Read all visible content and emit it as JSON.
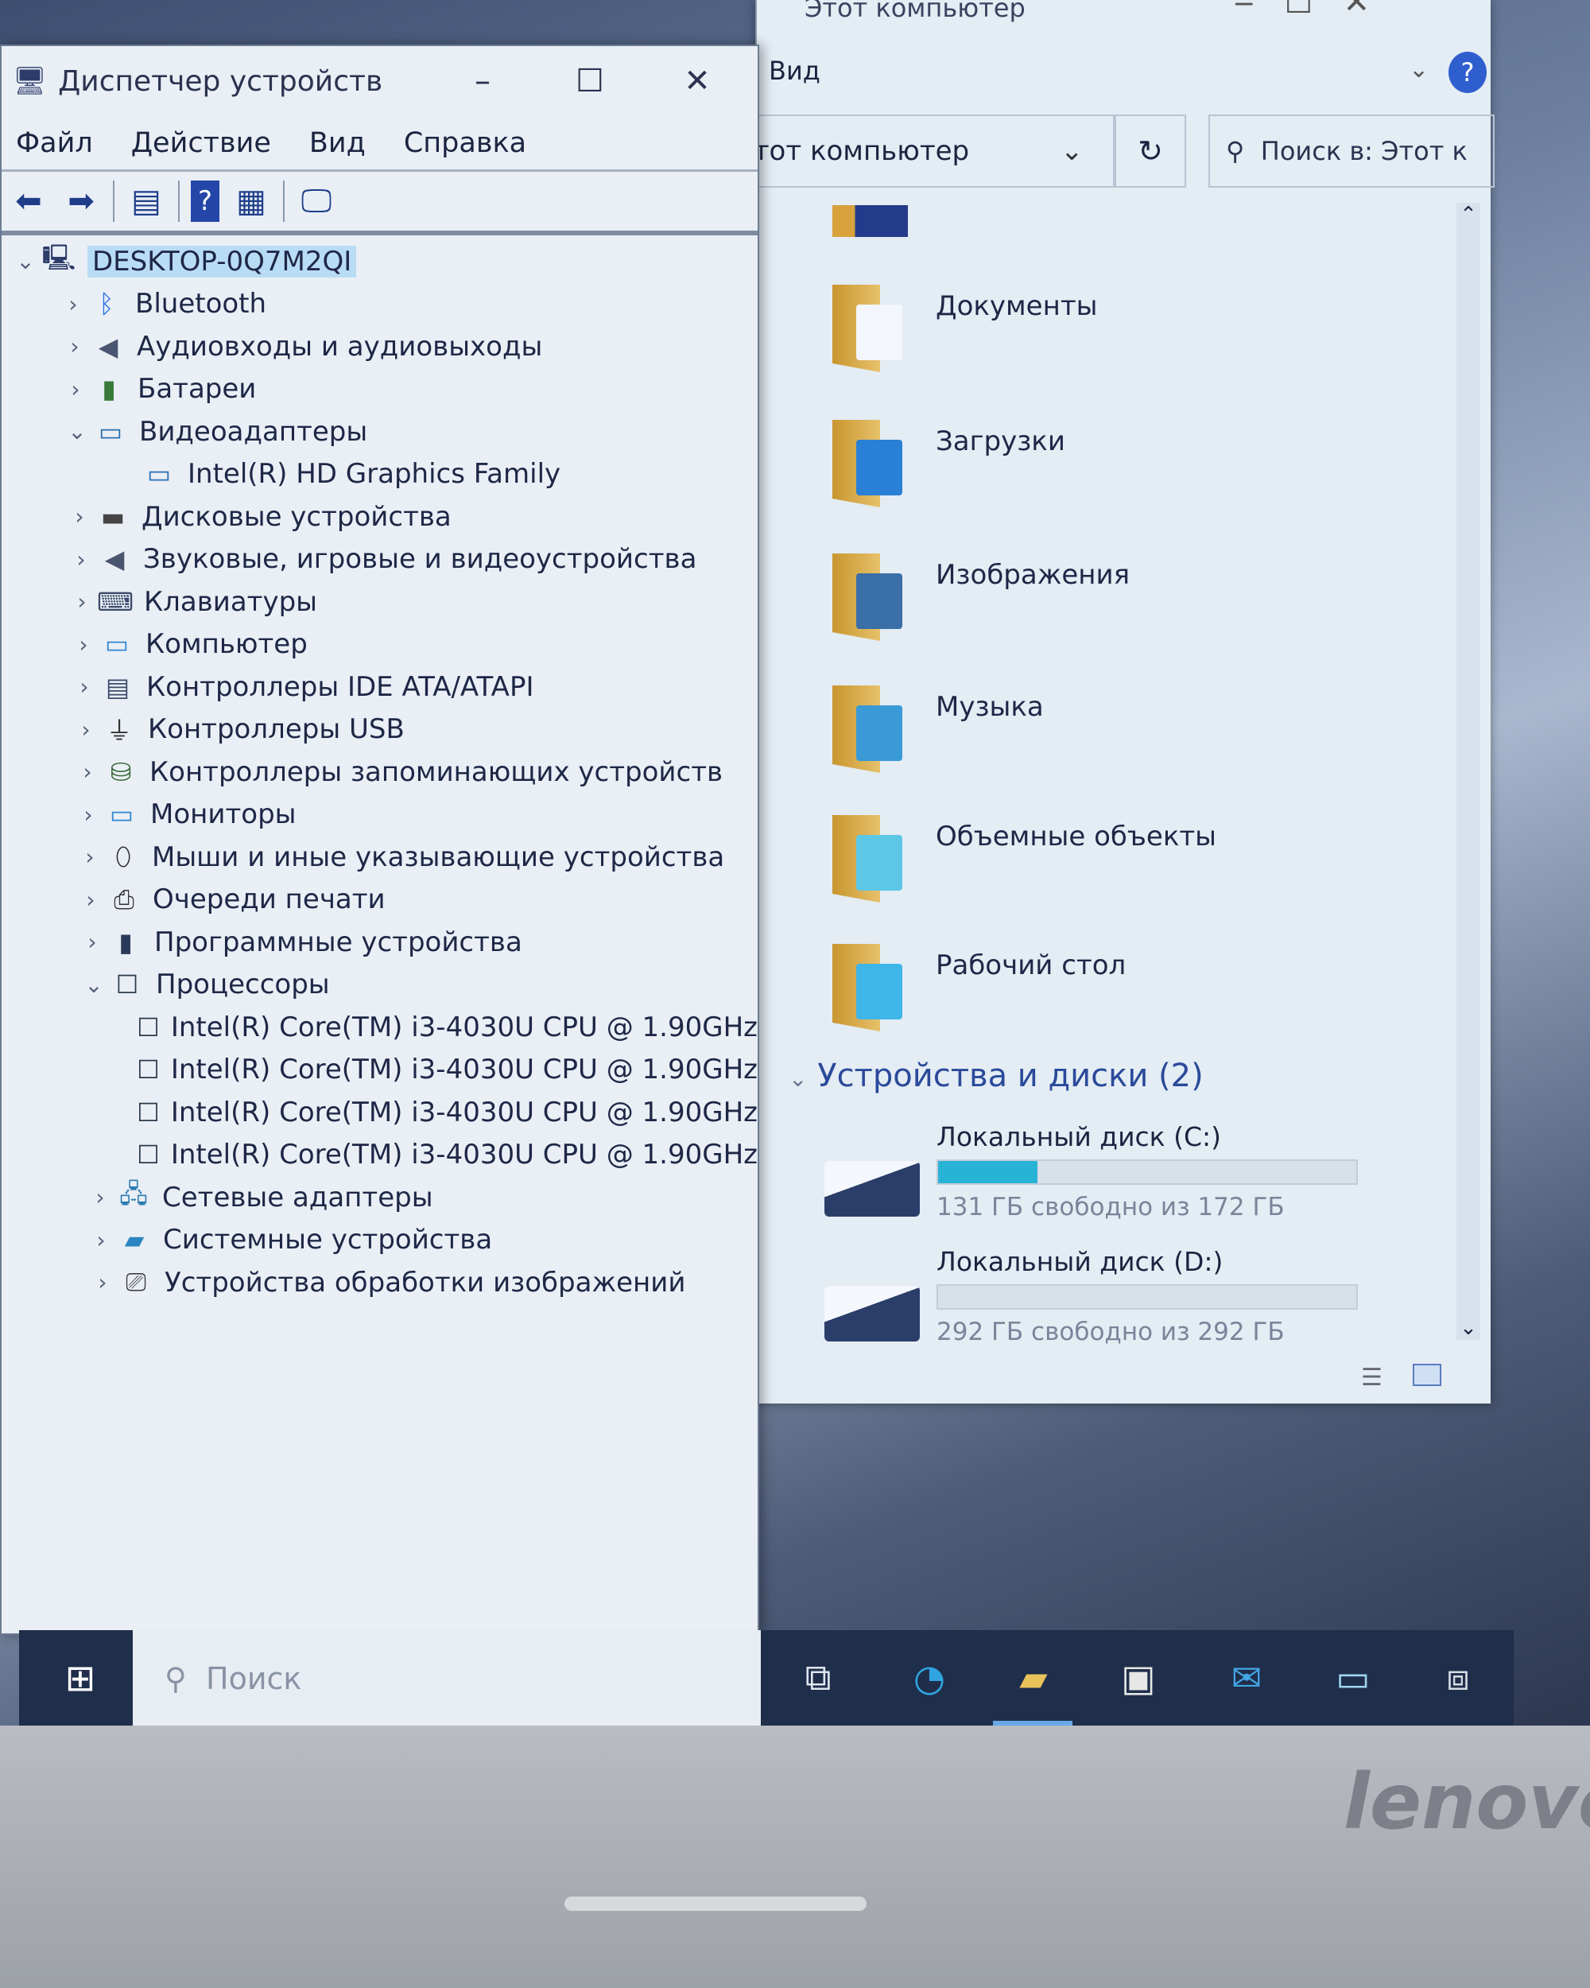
{
  "explorer": {
    "title": "Этот компьютер",
    "ribbon_tab": "Вид",
    "address": "Этот компьютер",
    "search_placeholder": "Поиск в: Этот к",
    "folders": [
      "Документы",
      "Загрузки",
      "Изображения",
      "Музыка",
      "Объемные объекты",
      "Рабочий стол"
    ],
    "section": "Устройства и диски (2)",
    "drives": [
      {
        "label": "Локальный диск (C:)",
        "status": "131 ГБ свободно из 172 ГБ",
        "used_fraction": 0.238
      },
      {
        "label": "Локальный диск (D:)",
        "status": "292 ГБ свободно из 292 ГБ",
        "used_fraction": 0.0
      }
    ]
  },
  "device_manager": {
    "title": "Диспетчер устройств",
    "menu": [
      "Файл",
      "Действие",
      "Вид",
      "Справка"
    ],
    "root": "DESKTOP-0Q7M2QI",
    "tree": [
      {
        "label": "Bluetooth",
        "icon": "bluetooth-icon",
        "expanded": false
      },
      {
        "label": "Аудиовходы и аудиовыходы",
        "icon": "speaker-icon",
        "expanded": false
      },
      {
        "label": "Батареи",
        "icon": "battery-icon",
        "expanded": false
      },
      {
        "label": "Видеоадаптеры",
        "icon": "display-adapter-icon",
        "expanded": true
      },
      {
        "label": "Intel(R) HD Graphics Family",
        "icon": "display-adapter-icon",
        "child": true
      },
      {
        "label": "Дисковые устройства",
        "icon": "disk-icon",
        "expanded": false
      },
      {
        "label": "Звуковые, игровые и видеоустройства",
        "icon": "speaker-icon",
        "expanded": false
      },
      {
        "label": "Клавиатуры",
        "icon": "keyboard-icon",
        "expanded": false
      },
      {
        "label": "Компьютер",
        "icon": "monitor-icon",
        "expanded": false
      },
      {
        "label": "Контроллеры IDE ATA/ATAPI",
        "icon": "ide-controller-icon",
        "expanded": false
      },
      {
        "label": "Контроллеры USB",
        "icon": "usb-icon",
        "expanded": false
      },
      {
        "label": "Контроллеры запоминающих устройств",
        "icon": "storage-controller-icon",
        "expanded": false
      },
      {
        "label": "Мониторы",
        "icon": "monitor-icon",
        "expanded": false
      },
      {
        "label": "Мыши и иные указывающие устройства",
        "icon": "mouse-icon",
        "expanded": false
      },
      {
        "label": "Очереди печати",
        "icon": "printer-icon",
        "expanded": false
      },
      {
        "label": "Программные устройства",
        "icon": "software-device-icon",
        "expanded": false
      },
      {
        "label": "Процессоры",
        "icon": "processor-icon",
        "expanded": true
      },
      {
        "label": "Intel(R) Core(TM) i3-4030U CPU @ 1.90GHz",
        "icon": "processor-icon",
        "child": true
      },
      {
        "label": "Intel(R) Core(TM) i3-4030U CPU @ 1.90GHz",
        "icon": "processor-icon",
        "child": true
      },
      {
        "label": "Intel(R) Core(TM) i3-4030U CPU @ 1.90GHz",
        "icon": "processor-icon",
        "child": true
      },
      {
        "label": "Intel(R) Core(TM) i3-4030U CPU @ 1.90GHz",
        "icon": "processor-icon",
        "child": true
      },
      {
        "label": "Сетевые адаптеры",
        "icon": "network-icon",
        "expanded": false
      },
      {
        "label": "Системные устройства",
        "icon": "system-folder-icon",
        "expanded": false
      },
      {
        "label": "Устройства обработки изображений",
        "icon": "camera-icon",
        "expanded": false
      }
    ]
  },
  "taskbar": {
    "search_placeholder": "Поиск",
    "apps": [
      "task-view-icon",
      "edge-icon",
      "file-explorer-icon",
      "store-icon",
      "mail-icon",
      "device-manager-icon",
      "network-app-icon"
    ]
  },
  "bezel": {
    "brand": "lenovo"
  },
  "colors": {
    "selection": "#b9dcf5",
    "drive_bar": "#27b3d6",
    "taskbar": "#1f2e4a"
  }
}
